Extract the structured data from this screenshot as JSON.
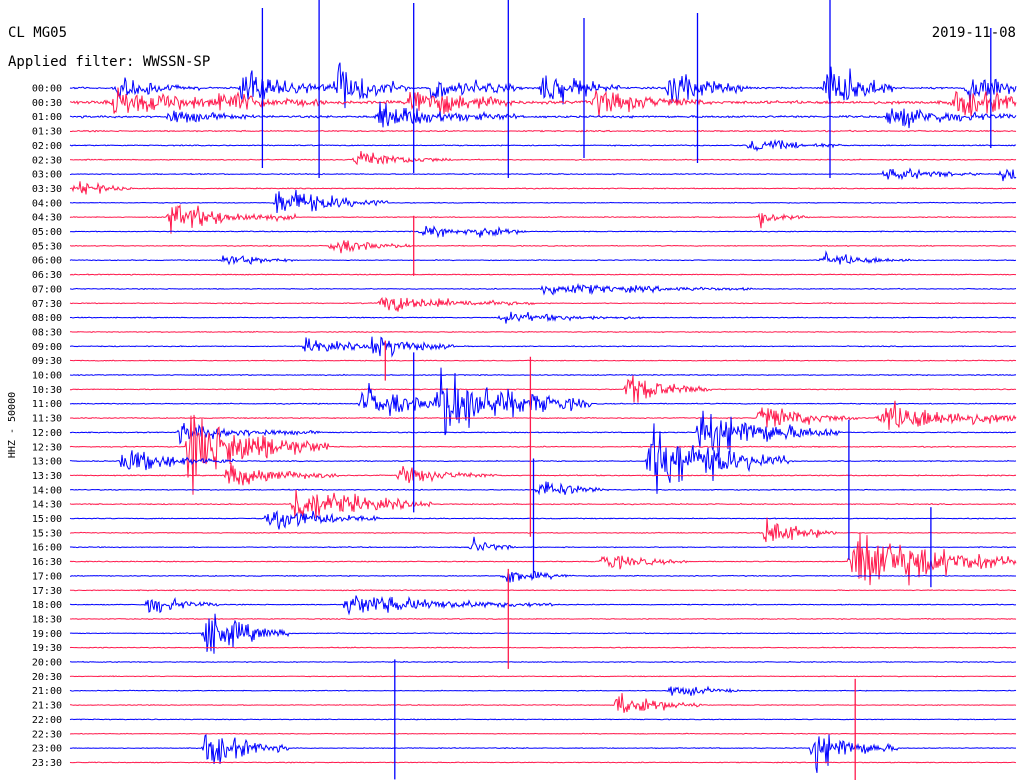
{
  "header": {
    "station": "CL MG05",
    "filter": "Applied filter: WWSSN-SP",
    "date": "2019-11-08"
  },
  "axis": {
    "left_label": "HHZ - 50000"
  },
  "colors": {
    "trace_a": "#0000ff",
    "trace_b": "#ff1a4d",
    "text": "#000000"
  },
  "chart_data": {
    "type": "helicorder",
    "row_labels": [
      "00:00",
      "00:30",
      "01:00",
      "01:30",
      "02:00",
      "02:30",
      "03:00",
      "03:30",
      "04:00",
      "04:30",
      "05:00",
      "05:30",
      "06:00",
      "06:30",
      "07:00",
      "07:30",
      "08:00",
      "08:30",
      "09:00",
      "09:30",
      "10:00",
      "10:30",
      "11:00",
      "11:30",
      "12:00",
      "12:30",
      "13:00",
      "13:30",
      "14:00",
      "14:30",
      "15:00",
      "15:30",
      "16:00",
      "16:30",
      "17:00",
      "17:30",
      "18:00",
      "18:30",
      "19:00",
      "19:30",
      "20:00",
      "20:30",
      "21:00",
      "21:30",
      "22:00",
      "22:30",
      "23:00",
      "23:30"
    ],
    "minutes_per_line": 30,
    "trace_colors_alternate": [
      "#0000ff",
      "#ff1a4d"
    ],
    "background_noise": [
      0.85,
      1.6,
      1.1,
      0.65,
      0.55,
      0.5,
      0.5,
      0.45,
      0.45,
      0.45,
      0.45,
      0.45,
      0.45,
      0.45,
      0.45,
      0.45,
      0.45,
      0.45,
      0.45,
      0.45,
      0.45,
      0.45,
      0.5,
      0.5,
      0.5,
      0.5,
      0.5,
      0.5,
      0.5,
      0.5,
      0.45,
      0.45,
      0.45,
      0.45,
      0.45,
      0.45,
      0.45,
      0.45,
      0.45,
      0.45,
      0.4,
      0.4,
      0.4,
      0.4,
      0.4,
      0.4,
      0.4,
      0.4
    ],
    "events": [
      {
        "row": 0,
        "minute": 1.5,
        "amp": 14,
        "dur": 1.2
      },
      {
        "row": 0,
        "minute": 5.5,
        "amp": 22,
        "dur": 1.5
      },
      {
        "row": 0,
        "minute": 8.5,
        "amp": 30,
        "dur": 1
      },
      {
        "row": 0,
        "minute": 11.5,
        "amp": 18,
        "dur": 1.3
      },
      {
        "row": 0,
        "minute": 15.0,
        "amp": 24,
        "dur": 1.1
      },
      {
        "row": 0,
        "minute": 19.0,
        "amp": 20,
        "dur": 1.2
      },
      {
        "row": 0,
        "minute": 24.0,
        "amp": 34,
        "dur": 1
      },
      {
        "row": 0,
        "minute": 28.5,
        "amp": 20,
        "dur": 1.2
      },
      {
        "row": 1,
        "minute": 1.4,
        "amp": 16,
        "dur": 2
      },
      {
        "row": 1,
        "minute": 4.8,
        "amp": 10,
        "dur": 1.5
      },
      {
        "row": 1,
        "minute": 10.8,
        "amp": 20,
        "dur": 1.5
      },
      {
        "row": 1,
        "minute": 16.6,
        "amp": 14,
        "dur": 1.6
      },
      {
        "row": 1,
        "minute": 28.0,
        "amp": 16,
        "dur": 2
      },
      {
        "row": 2,
        "minute": 3.2,
        "amp": 8,
        "dur": 1.2
      },
      {
        "row": 2,
        "minute": 9.8,
        "amp": 14,
        "dur": 2
      },
      {
        "row": 2,
        "minute": 26.0,
        "amp": 12,
        "dur": 2
      },
      {
        "row": 4,
        "minute": 21.6,
        "amp": 8,
        "dur": 1.3
      },
      {
        "row": 5,
        "minute": 9.1,
        "amp": 10,
        "dur": 1.4
      },
      {
        "row": 6,
        "minute": 25.9,
        "amp": 8,
        "dur": 1.4
      },
      {
        "row": 6,
        "minute": 29.6,
        "amp": 8,
        "dur": 0.6
      },
      {
        "row": 7,
        "minute": 0.2,
        "amp": 10,
        "dur": 0.8
      },
      {
        "row": 8,
        "minute": 6.6,
        "amp": 18,
        "dur": 1.6
      },
      {
        "row": 9,
        "minute": 3.2,
        "amp": 16,
        "dur": 1.8
      },
      {
        "row": 9,
        "minute": 21.9,
        "amp": 10,
        "dur": 0.7
      },
      {
        "row": 10,
        "minute": 11.2,
        "amp": 8,
        "dur": 0.9
      },
      {
        "row": 10,
        "minute": 13.0,
        "amp": 10,
        "dur": 0.7
      },
      {
        "row": 11,
        "minute": 8.3,
        "amp": 9,
        "dur": 1.2
      },
      {
        "row": 12,
        "minute": 4.9,
        "amp": 8,
        "dur": 1
      },
      {
        "row": 12,
        "minute": 23.9,
        "amp": 8,
        "dur": 1.4
      },
      {
        "row": 14,
        "minute": 15.0,
        "amp": 7,
        "dur": 3
      },
      {
        "row": 15,
        "minute": 9.9,
        "amp": 10,
        "dur": 2.2
      },
      {
        "row": 16,
        "minute": 13.7,
        "amp": 6,
        "dur": 2
      },
      {
        "row": 18,
        "minute": 7.5,
        "amp": 8,
        "dur": 1.4
      },
      {
        "row": 18,
        "minute": 9.6,
        "amp": 14,
        "dur": 1.2
      },
      {
        "row": 21,
        "minute": 17.7,
        "amp": 18,
        "dur": 1.2
      },
      {
        "row": 22,
        "minute": 9.3,
        "amp": 22,
        "dur": 1.4
      },
      {
        "row": 22,
        "minute": 11.7,
        "amp": 40,
        "dur": 2.2
      },
      {
        "row": 23,
        "minute": 21.9,
        "amp": 16,
        "dur": 1.4
      },
      {
        "row": 23,
        "minute": 25.7,
        "amp": 18,
        "dur": 2.6
      },
      {
        "row": 24,
        "minute": 3.5,
        "amp": 10,
        "dur": 2
      },
      {
        "row": 24,
        "minute": 20.0,
        "amp": 30,
        "dur": 2
      },
      {
        "row": 25,
        "minute": 3.8,
        "amp": 42,
        "dur": 2
      },
      {
        "row": 26,
        "minute": 1.7,
        "amp": 14,
        "dur": 1.6
      },
      {
        "row": 26,
        "minute": 18.4,
        "amp": 40,
        "dur": 2
      },
      {
        "row": 27,
        "minute": 5.0,
        "amp": 14,
        "dur": 1.6
      },
      {
        "row": 27,
        "minute": 10.5,
        "amp": 10,
        "dur": 1.4
      },
      {
        "row": 28,
        "minute": 14.9,
        "amp": 12,
        "dur": 1
      },
      {
        "row": 29,
        "minute": 7.1,
        "amp": 22,
        "dur": 2
      },
      {
        "row": 30,
        "minute": 6.3,
        "amp": 16,
        "dur": 1.6
      },
      {
        "row": 31,
        "minute": 22.1,
        "amp": 18,
        "dur": 1
      },
      {
        "row": 32,
        "minute": 12.8,
        "amp": 10,
        "dur": 0.6
      },
      {
        "row": 33,
        "minute": 24.8,
        "amp": 40,
        "dur": 2.5
      },
      {
        "row": 33,
        "minute": 16.9,
        "amp": 10,
        "dur": 1.2
      },
      {
        "row": 34,
        "minute": 13.8,
        "amp": 10,
        "dur": 1
      },
      {
        "row": 36,
        "minute": 2.5,
        "amp": 12,
        "dur": 1
      },
      {
        "row": 36,
        "minute": 8.8,
        "amp": 12,
        "dur": 3
      },
      {
        "row": 38,
        "minute": 4.3,
        "amp": 26,
        "dur": 1.2
      },
      {
        "row": 42,
        "minute": 19.1,
        "amp": 8,
        "dur": 1
      },
      {
        "row": 43,
        "minute": 17.4,
        "amp": 16,
        "dur": 1.2
      },
      {
        "row": 46,
        "minute": 4.3,
        "amp": 22,
        "dur": 1.2
      },
      {
        "row": 46,
        "minute": 23.6,
        "amp": 24,
        "dur": 1.2
      }
    ],
    "spikes": [
      {
        "row": 0,
        "minute": 6.1,
        "amp": 80
      },
      {
        "row": 0,
        "minute": 7.9,
        "amp": 90
      },
      {
        "row": 0,
        "minute": 10.9,
        "amp": 85
      },
      {
        "row": 0,
        "minute": 13.9,
        "amp": 90
      },
      {
        "row": 0,
        "minute": 16.3,
        "amp": 70
      },
      {
        "row": 0,
        "minute": 19.9,
        "amp": 75
      },
      {
        "row": 0,
        "minute": 24.1,
        "amp": 90
      },
      {
        "row": 0,
        "minute": 29.2,
        "amp": 60
      },
      {
        "row": 11,
        "minute": 10.9,
        "amp": 30
      },
      {
        "row": 19,
        "minute": 10.0,
        "amp": 20
      },
      {
        "row": 24,
        "minute": 10.9,
        "amp": 80
      },
      {
        "row": 25,
        "minute": 14.6,
        "amp": 90
      },
      {
        "row": 28,
        "minute": 24.7,
        "amp": 70
      },
      {
        "row": 30,
        "minute": 14.7,
        "amp": 60
      },
      {
        "row": 32,
        "minute": 27.3,
        "amp": 40
      },
      {
        "row": 37,
        "minute": 13.9,
        "amp": 50
      },
      {
        "row": 44,
        "minute": 10.3,
        "amp": 60
      },
      {
        "row": 45,
        "minute": 24.9,
        "amp": 55
      }
    ]
  }
}
